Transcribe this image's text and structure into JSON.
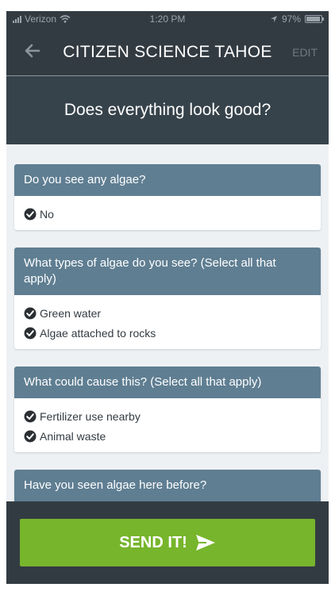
{
  "status_bar": {
    "carrier": "Verizon",
    "time": "1:20 PM",
    "battery_text": "97%",
    "battery_level": 0.97
  },
  "nav": {
    "title": "CITIZEN SCIENCE TAHOE",
    "edit_label": "EDIT",
    "back_icon": "arrow-left-icon"
  },
  "header": {
    "title": "Does everything look good?"
  },
  "cards": [
    {
      "question": "Do you see any algae?",
      "answers": [
        "No"
      ]
    },
    {
      "question": "What types of algae do you see? (Select all that apply)",
      "answers": [
        "Green water",
        "Algae attached to rocks"
      ]
    },
    {
      "question": "What could cause this? (Select all that apply)",
      "answers": [
        "Fertilizer use nearby",
        "Animal waste"
      ]
    },
    {
      "question": "Have you seen algae here before?",
      "answers": []
    }
  ],
  "footer": {
    "send_label": "SEND IT!",
    "send_icon": "paper-plane-icon"
  },
  "colors": {
    "nav_bg": "#333b42",
    "header_bg": "#37434b",
    "question_bg": "#5f7e92",
    "send_green": "#77b52c"
  }
}
